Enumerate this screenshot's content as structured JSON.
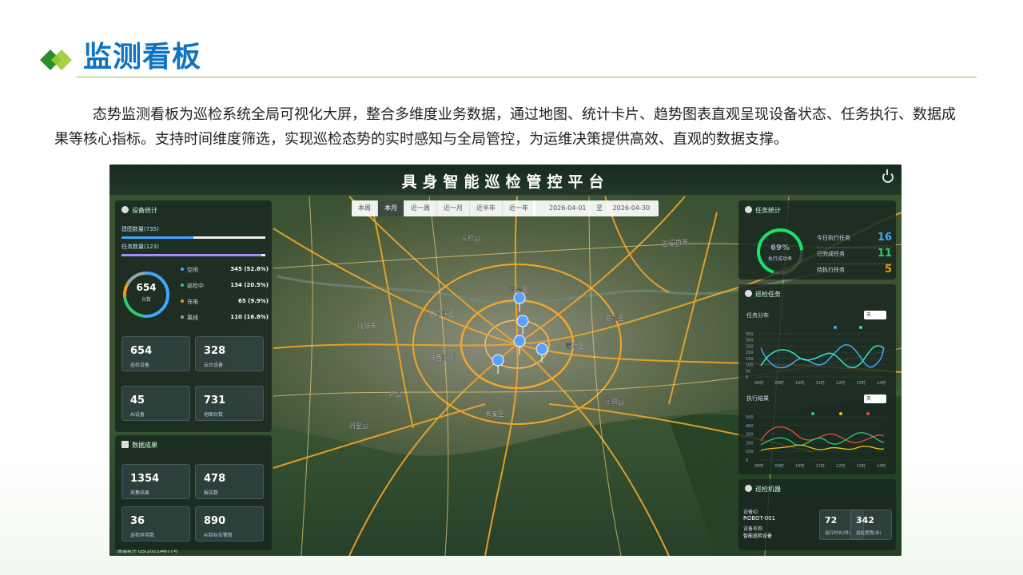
{
  "slide": {
    "title": "监测看板",
    "intro": "态势监测看板为巡检系统全局可视化大屏，整合多维度业务数据，通过地图、统计卡片、趋势图表直观呈现设备状态、任务执行、数据成果等核心指标。支持时间维度筛选，实现巡检态势的实时感知与全局管控，为运维决策提供高效、直观的数据支撑。",
    "colors": {
      "title": "#0e74c2",
      "rule": "#8bc34a",
      "logo_dark": "#2e8b2e",
      "logo_light": "#9acd32"
    }
  },
  "dashboard": {
    "title": "具身智能巡检管控平台",
    "filters": [
      "本周",
      "本月",
      "近一周",
      "近一月",
      "近半年",
      "近一年"
    ],
    "active_filter": "本月",
    "date_start": "2026-04-01",
    "date_sep": "至",
    "date_end": "2026-04-30",
    "device_panel": {
      "title": "设备统计",
      "bar1_label": "建图数量(735)",
      "bar1_fraction": 0.5,
      "bar2_label": "任务数量(123)",
      "bar2_fraction": 0.97,
      "ring_value": "654",
      "ring_label": "台数",
      "legend": [
        {
          "label": "空闲",
          "value": "345 (52.8%)",
          "color": "#3fa7ff"
        },
        {
          "label": "巡检中",
          "value": "134 (20.5%)",
          "color": "#2ecc71"
        },
        {
          "label": "充电",
          "value": "65 (9.9%)",
          "color": "#f39c12"
        },
        {
          "label": "离线",
          "value": "110 (16.8%)",
          "color": "#95a5a6"
        }
      ],
      "cards": [
        {
          "value": "654",
          "label": "巡检设备"
        },
        {
          "value": "328",
          "label": "云台设备"
        },
        {
          "value": "45",
          "label": "AI设备"
        },
        {
          "value": "731",
          "label": "地图台数"
        }
      ]
    },
    "data_panel": {
      "title": "数据成果",
      "cards": [
        {
          "value": "1354",
          "label": "采集结果"
        },
        {
          "value": "478",
          "label": "报告数"
        },
        {
          "value": "36",
          "label": "巡检异常数"
        },
        {
          "value": "890",
          "label": "AI目标告警数"
        }
      ]
    },
    "task_panel": {
      "title": "任务统计",
      "ring_value": "69%",
      "ring_label": "执行成功率",
      "ring_fraction": 0.69,
      "rows": [
        {
          "label": "今日执行任务",
          "value": "16",
          "color": "#3fa7ff"
        },
        {
          "label": "已完成任务",
          "value": "11",
          "color": "#2ecc71"
        },
        {
          "label": "待执行任务",
          "value": "5",
          "color": "#f39c12"
        }
      ]
    },
    "trend_panel": {
      "title": "巡检任务",
      "chart1_title": "任务分布",
      "chart2_title": "执行结果",
      "select_value": "天",
      "chart1_yticks": [
        "350",
        "300",
        "250",
        "200",
        "150",
        "100",
        "50",
        "0"
      ],
      "chart2_yticks": [
        "500",
        "400",
        "300",
        "200",
        "100",
        "0"
      ],
      "xticks": [
        "08时",
        "09时",
        "10时",
        "11时",
        "12时",
        "13时",
        "14时"
      ]
    },
    "robot_panel": {
      "title": "巡检机器",
      "id_label": "设备ID",
      "id_value": "ROBOT-001",
      "name_label": "设备名称",
      "name_value": "智能巡检设备",
      "cards": [
        {
          "value": "72",
          "label": "运行时长(时)"
        },
        {
          "value": "342",
          "label": "巡检里程(米)"
        }
      ]
    },
    "map_places": [
      "泾阳县",
      "三原县",
      "高陵区",
      "西咸新区",
      "咸阳市",
      "户县",
      "长安区",
      "蓝田县",
      "临潼区",
      "渭南市",
      "周至县",
      "沣西新城",
      "灞桥区"
    ],
    "footer_text": "高德软件 GS(2023)4677号"
  }
}
